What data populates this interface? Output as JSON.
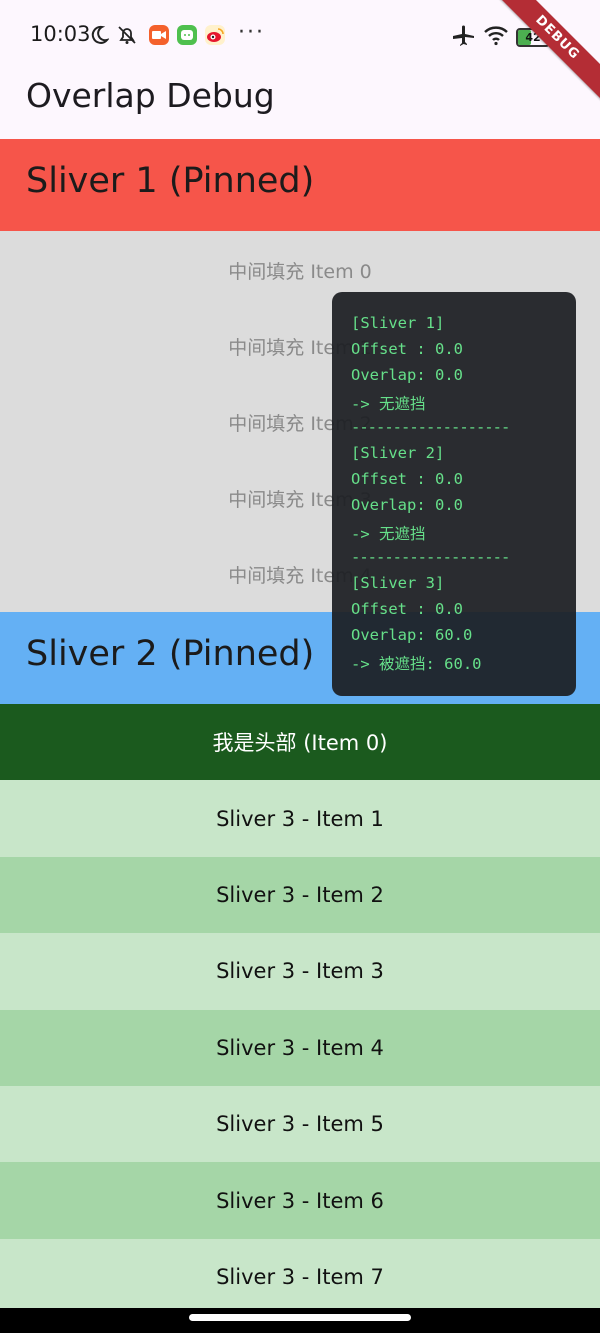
{
  "status_bar": {
    "time": "10:03",
    "icons": [
      "moon-icon",
      "bell-off-icon",
      "video-app-icon",
      "wechat-app-icon",
      "weibo-app-icon"
    ],
    "more": "···",
    "battery": "42",
    "debug_banner": "DEBUG"
  },
  "appbar": {
    "title": "Overlap Debug"
  },
  "sliver1": {
    "title": "Sliver 1 (Pinned)",
    "color": "#f6554a"
  },
  "filler": {
    "items": [
      "中间填充 Item 0",
      "中间填充 Item 1",
      "中间填充 Item 2",
      "中间填充 Item 3",
      "中间填充 Item 4"
    ]
  },
  "sliver2": {
    "title": "Sliver 2 (Pinned)",
    "color": "#64b0f4"
  },
  "sliver3": {
    "header": "我是头部 (Item 0)",
    "items": [
      "Sliver 3 - Item 1",
      "Sliver 3 - Item 2",
      "Sliver 3 - Item 3",
      "Sliver 3 - Item 4",
      "Sliver 3 - Item 5",
      "Sliver 3 - Item 6",
      "Sliver 3 - Item 7"
    ]
  },
  "debug_panel": {
    "lines": [
      "[Sliver 1]",
      "Offset : 0.0",
      "Overlap: 0.0",
      "-> 无遮挡",
      "-------------------",
      "[Sliver 2]",
      "Offset : 0.0",
      "Overlap: 0.0",
      "-> 无遮挡",
      "-------------------",
      "[Sliver 3]",
      "Offset : 0.0",
      "Overlap: 60.0",
      "-> 被遮挡: 60.0"
    ]
  }
}
